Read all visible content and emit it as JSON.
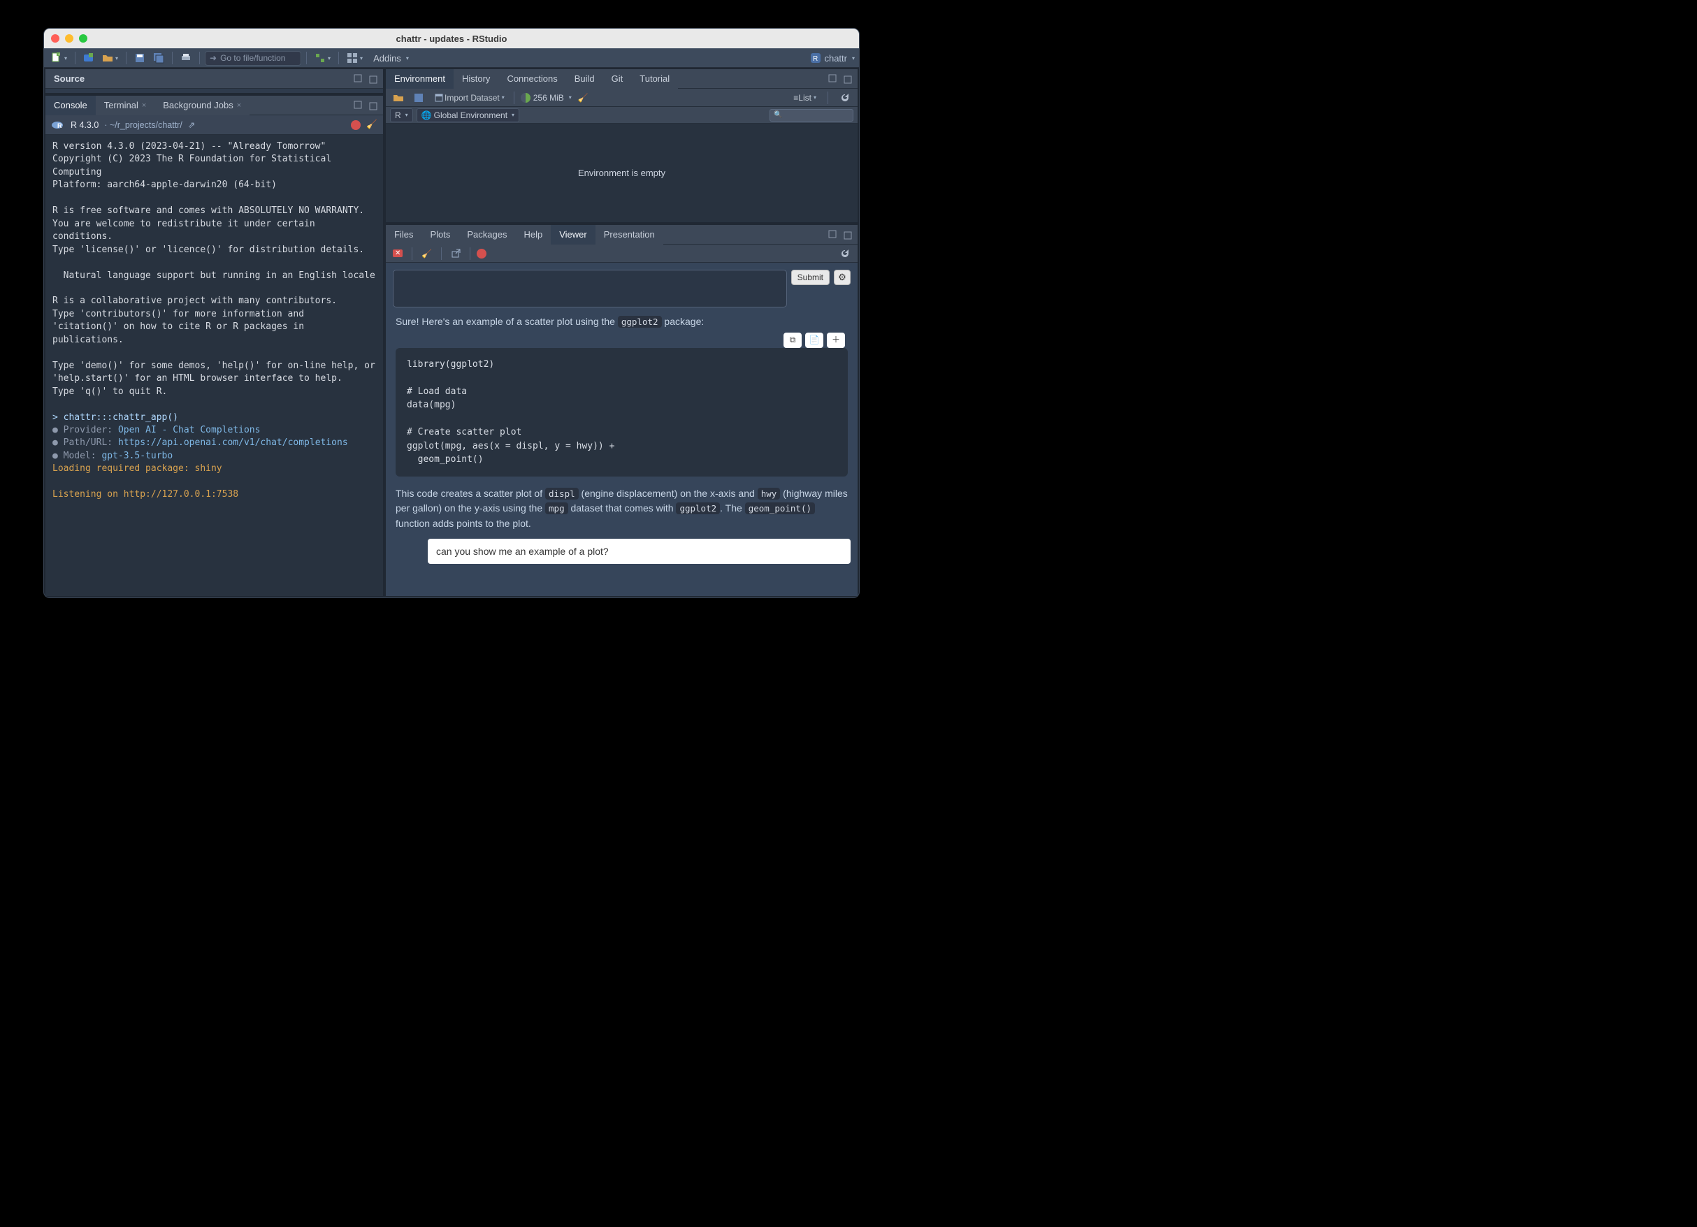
{
  "window": {
    "title": "chattr - updates - RStudio"
  },
  "toolbar": {
    "goto_placeholder": "Go to file/function",
    "addins_label": "Addins",
    "project_label": "chattr"
  },
  "source_pane": {
    "title": "Source"
  },
  "console_pane": {
    "tabs": [
      "Console",
      "Terminal",
      "Background Jobs"
    ],
    "r_version": "R 4.3.0",
    "working_dir": "~/r_projects/chattr/",
    "banner": "R version 4.3.0 (2023-04-21) -- \"Already Tomorrow\"\nCopyright (C) 2023 The R Foundation for Statistical Computing\nPlatform: aarch64-apple-darwin20 (64-bit)\n\nR is free software and comes with ABSOLUTELY NO WARRANTY.\nYou are welcome to redistribute it under certain conditions.\nType 'license()' or 'licence()' for distribution details.\n\n  Natural language support but running in an English locale\n\nR is a collaborative project with many contributors.\nType 'contributors()' for more information and\n'citation()' on how to cite R or R packages in publications.\n\nType 'demo()' for some demos, 'help()' for on-line help, or\n'help.start()' for an HTML browser interface to help.\nType 'q()' to quit R.\n",
    "prompt_line": "> chattr:::chattr_app()",
    "provider_label": "Provider:",
    "provider_value": "Open AI - Chat Completions",
    "path_label": "Path/URL:",
    "path_value": "https://api.openai.com/v1/chat/completions",
    "model_label": "Model:",
    "model_value": "gpt-3.5-turbo",
    "loading_line": "Loading required package: shiny",
    "listening_line": "Listening on http://127.0.0.1:7538"
  },
  "env_pane": {
    "tabs": [
      "Environment",
      "History",
      "Connections",
      "Build",
      "Git",
      "Tutorial"
    ],
    "import_label": "Import Dataset",
    "memory": "256 MiB",
    "scope_label": "Global Environment",
    "view_label": "List",
    "lang_label": "R",
    "empty_text": "Environment is empty"
  },
  "viewer_pane": {
    "tabs": [
      "Files",
      "Plots",
      "Packages",
      "Help",
      "Viewer",
      "Presentation"
    ],
    "submit_label": "Submit",
    "assistant_pre_text": "Sure! Here's an example of a scatter plot using the ",
    "assistant_code_pkg": "ggplot2",
    "assistant_post_text": " package:",
    "code_block": "library(ggplot2)\n\n# Load data\ndata(mpg)\n\n# Create scatter plot\nggplot(mpg, aes(x = displ, y = hwy)) +\n  geom_point()",
    "explain": {
      "p1a": "This code creates a scatter plot of ",
      "c_displ": "displ",
      "p1b": " (engine displacement) on the x-axis and ",
      "c_hwy": "hwy",
      "p1c": " (highway miles per gallon) on the y-axis using the ",
      "c_mpg": "mpg",
      "p1d": " dataset that comes with ",
      "c_gg": "ggplot2",
      "p1e": ". The ",
      "c_geom": "geom_point()",
      "p1f": " function adds points to the plot."
    },
    "user_message": "can you show me an example of a plot?"
  }
}
